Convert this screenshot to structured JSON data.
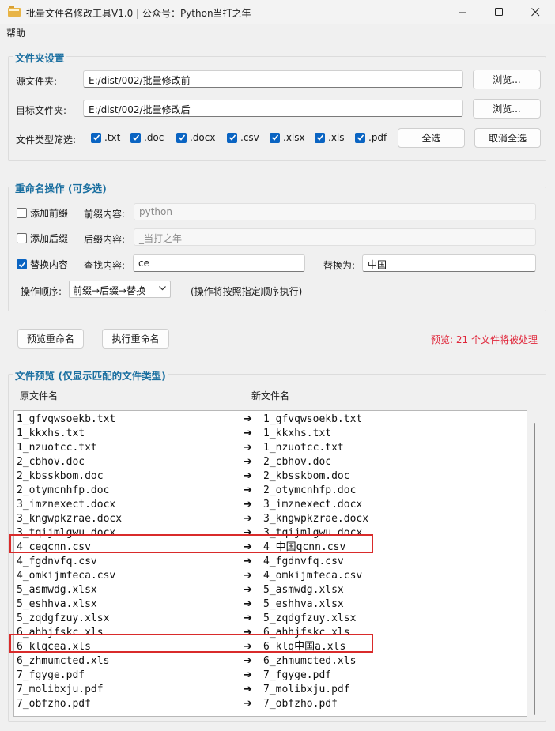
{
  "window": {
    "title": "批量文件名修改工具V1.0 | 公众号：Python当打之年",
    "icon": "folder-icon"
  },
  "menu": {
    "help": "帮助"
  },
  "folder_settings": {
    "title": "文件夹设置",
    "source_label": "源文件夹:",
    "source_value": "E:/dist/002/批量修改前",
    "target_label": "目标文件夹:",
    "target_value": "E:/dist/002/批量修改后",
    "browse_label": "浏览...",
    "filter_label": "文件类型筛选:",
    "types": [
      {
        "label": ".txt",
        "checked": true
      },
      {
        "label": ".doc",
        "checked": true
      },
      {
        "label": ".docx",
        "checked": true
      },
      {
        "label": ".csv",
        "checked": true
      },
      {
        "label": ".xlsx",
        "checked": true
      },
      {
        "label": ".xls",
        "checked": true
      },
      {
        "label": ".pdf",
        "checked": true
      }
    ],
    "select_all": "全选",
    "deselect_all": "取消全选"
  },
  "rename_ops": {
    "title": "重命名操作 (可多选)",
    "add_prefix": {
      "label": "添加前缀",
      "checked": false,
      "field_label": "前缀内容:",
      "value": "python_"
    },
    "add_suffix": {
      "label": "添加后缀",
      "checked": false,
      "field_label": "后缀内容:",
      "value": "_当打之年"
    },
    "replace": {
      "label": "替换内容",
      "checked": true,
      "find_label": "查找内容:",
      "find_value": "ce",
      "replace_label": "替换为:",
      "replace_value": "中国"
    },
    "order_label": "操作顺序:",
    "order_value": "前缀→后缀→替换",
    "order_hint": "(操作将按照指定顺序执行)"
  },
  "actions": {
    "preview": "预览重命名",
    "execute": "执行重命名",
    "status": "预览: 21 个文件将被处理"
  },
  "file_preview": {
    "title": "文件预览 (仅显示匹配的文件类型)",
    "col_original": "原文件名",
    "col_new": "新文件名",
    "arrow": "➔",
    "rows": [
      {
        "orig": "1_gfvqwsoekb.txt",
        "new": "1_gfvqwsoekb.txt"
      },
      {
        "orig": "1_kkxhs.txt",
        "new": "1_kkxhs.txt"
      },
      {
        "orig": "1_nzuotcc.txt",
        "new": "1_nzuotcc.txt"
      },
      {
        "orig": "2_cbhov.doc",
        "new": "2_cbhov.doc"
      },
      {
        "orig": "2_kbsskbom.doc",
        "new": "2_kbsskbom.doc"
      },
      {
        "orig": "2_otymcnhfp.doc",
        "new": "2_otymcnhfp.doc"
      },
      {
        "orig": "3_imznexect.docx",
        "new": "3_imznexect.docx"
      },
      {
        "orig": "3_kngwpkzrae.docx",
        "new": "3_kngwpkzrae.docx"
      },
      {
        "orig": "3_tqijmlgwu.docx",
        "new": "3_tqijmlgwu.docx"
      },
      {
        "orig": "4_ceqcnn.csv",
        "new": "4_中国qcnn.csv",
        "highlight": true
      },
      {
        "orig": "4_fgdnvfq.csv",
        "new": "4_fgdnvfq.csv"
      },
      {
        "orig": "4_omkijmfeca.csv",
        "new": "4_omkijmfeca.csv"
      },
      {
        "orig": "5_asmwdg.xlsx",
        "new": "5_asmwdg.xlsx"
      },
      {
        "orig": "5_eshhva.xlsx",
        "new": "5_eshhva.xlsx"
      },
      {
        "orig": "5_zqdgfzuy.xlsx",
        "new": "5_zqdgfzuy.xlsx"
      },
      {
        "orig": "6_ahhjfskc.xls",
        "new": "6_ahhjfskc.xls"
      },
      {
        "orig": "6_klqcea.xls",
        "new": "6_klq中国a.xls",
        "highlight": true
      },
      {
        "orig": "6_zhmumcted.xls",
        "new": "6_zhmumcted.xls"
      },
      {
        "orig": "7_fgyge.pdf",
        "new": "7_fgyge.pdf"
      },
      {
        "orig": "7_molibxju.pdf",
        "new": "7_molibxju.pdf"
      },
      {
        "orig": "7_obfzho.pdf",
        "new": "7_obfzho.pdf"
      }
    ]
  },
  "colors": {
    "accent": "#1a6fa0",
    "status_red": "#e0263a",
    "highlight_border": "#d92b2b",
    "checkbox_blue": "#0a64c2"
  }
}
